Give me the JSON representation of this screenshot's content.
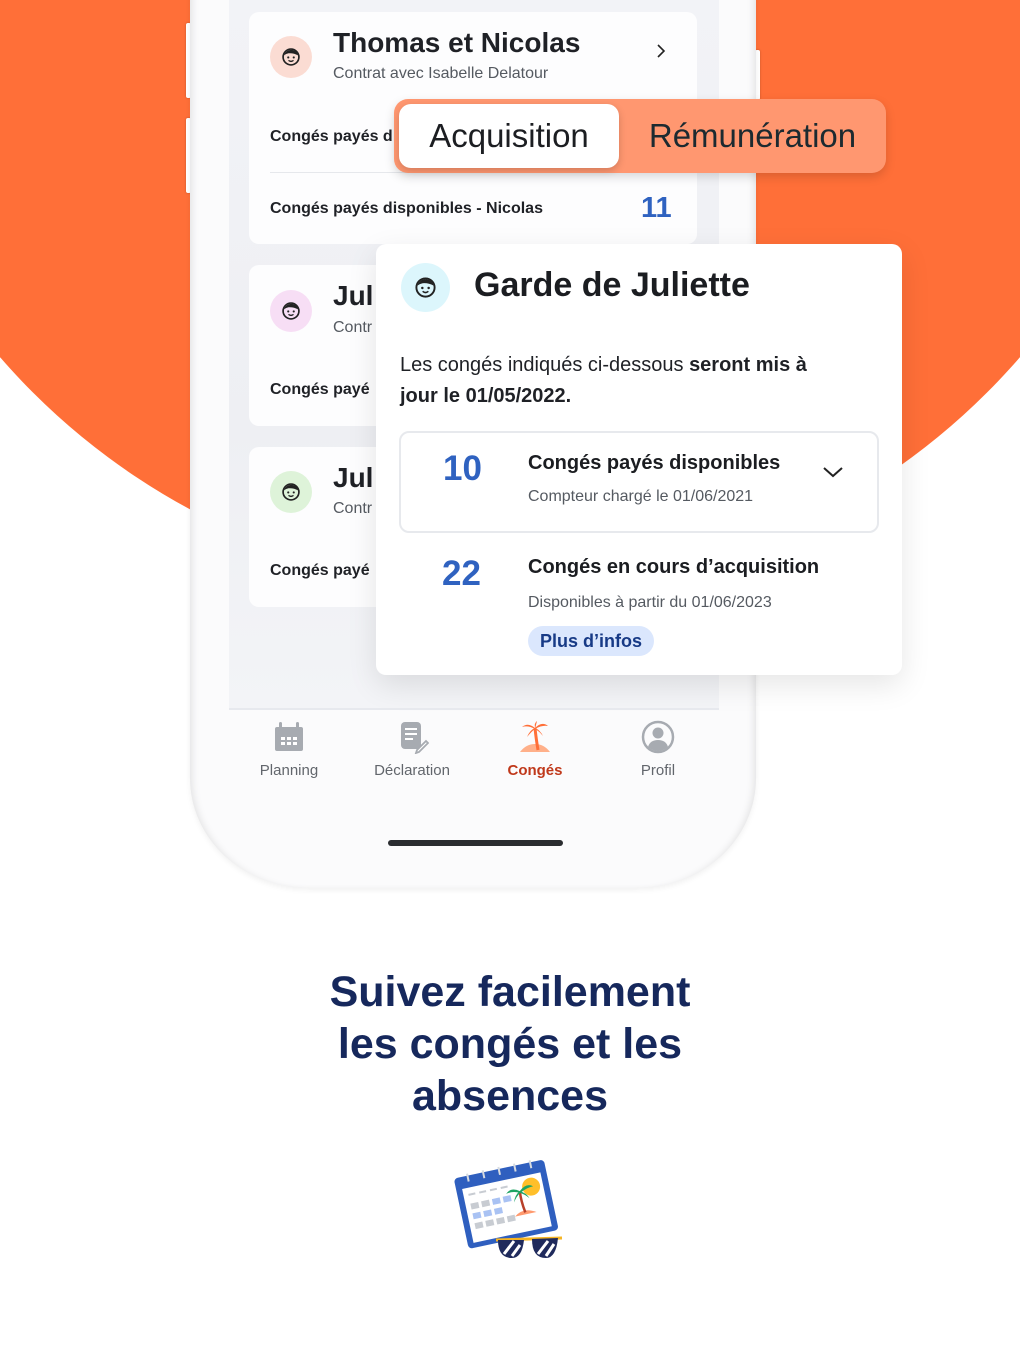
{
  "colors": {
    "brand_orange": "#ff6f38",
    "segment_bg": "#ff9770",
    "counter_blue": "#2f62c0",
    "active_tab": "#c0391b",
    "tagline": "#16285c",
    "pill_bg": "#dbe7fd"
  },
  "contracts": [
    {
      "title": "Thomas et Nicolas",
      "subtitle": "Contrat avec Isabelle Delatour",
      "avatar_color": "#fbdcd3",
      "rows": [
        {
          "label": "Congés payés d",
          "value": ""
        },
        {
          "label": "Congés payés disponibles - Nicolas",
          "value": "11"
        }
      ]
    },
    {
      "title": "Jul",
      "subtitle": "Contr",
      "avatar_color": "#f7def5",
      "rows": [
        {
          "label": "Congés payé",
          "value": ""
        }
      ]
    },
    {
      "title": "Jul",
      "subtitle": "Contr",
      "avatar_color": "#def3d9",
      "rows": [
        {
          "label": "Congés payé",
          "value": ""
        }
      ]
    }
  ],
  "segment": {
    "options": [
      "Acquisition",
      "Rémunération"
    ],
    "selected": "Acquisition"
  },
  "detail": {
    "title": "Garde de Juliette",
    "note_regular": "Les congés indiqués ci-dessous ",
    "note_bold": "seront mis à jour le 01/05/2022.",
    "counters": [
      {
        "value": "10",
        "label": "Congés payés disponibles",
        "sub": "Compteur chargé le 01/06/2021",
        "expandable": true
      },
      {
        "value": "22",
        "label": "Congés en cours d’acquisition",
        "sub": "Disponibles à partir du 01/06/2023",
        "link": "Plus d’infos"
      }
    ]
  },
  "nav": {
    "items": [
      {
        "label": "Planning",
        "icon": "calendar-icon",
        "active": false
      },
      {
        "label": "Déclaration",
        "icon": "document-edit-icon",
        "active": false
      },
      {
        "label": "Congés",
        "icon": "palm-island-icon",
        "active": true
      },
      {
        "label": "Profil",
        "icon": "user-circle-icon",
        "active": false
      }
    ]
  },
  "tagline": {
    "lines": [
      "Suivez facilement",
      "les congés et les",
      "absences"
    ]
  },
  "illustration": "calendar-vacation-icon"
}
